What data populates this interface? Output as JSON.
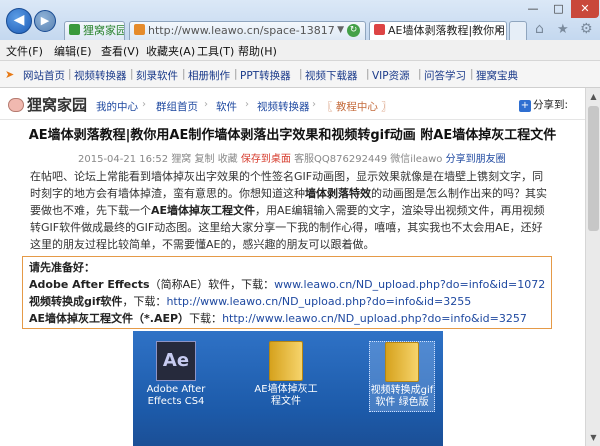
{
  "browser": {
    "window_controls": {
      "minimize": "—",
      "maximize": "□",
      "close": "✕"
    },
    "tabs": [
      {
        "label": "狸窝家园",
        "chip": "证"
      },
      {
        "label": "http://www.leawo.cn/space-13817"
      },
      {
        "label": "AE墙体剥落教程|教你用...",
        "close": "✕"
      }
    ],
    "menu": [
      "文件(F)",
      "编辑(E)",
      "查看(V)",
      "收藏夹(A)",
      "工具(T)",
      "帮助(H)"
    ],
    "favorites": [
      "网站首页",
      "视频转换器",
      "刻录软件",
      "相册制作",
      "PPT转换器",
      "视频下载器",
      "VIP资源",
      "问答学习",
      "狸窝宝典"
    ]
  },
  "page": {
    "logo": "狸窝家园",
    "breadcrumb": [
      "我的中心",
      "群组首页",
      "软件",
      "视频转换器",
      "〖 教程中心 〗"
    ],
    "share": "分享到:",
    "title": "AE墙体剥落教程|教你用AE制作墙体剥落出字效果和视频转gif动画 附AE墙体掉灰工程文件",
    "meta": {
      "date": "2015-04-21 16:52",
      "author": "狸窝",
      "copy": "复制",
      "collect": "收藏",
      "save": "保存到桌面",
      "contact": "客服QQ876292449 微信ileawo",
      "share_friends": "分享到朋友圈"
    },
    "paragraph": {
      "p1": "在帖吧、论坛上常能看到墙体掉灰出字效果的个性签名GIF动画图，显示效果就像是在墙壁上镌刻文字，同时刻字的地方会有墙体掉渣，蛮有意思的。你想知道这种",
      "b1": "墙体剥落特效",
      "p2": "的动画图是怎么制作出来的吗？其实要做也不难，先下载一个",
      "b2": "AE墙体掉灰工程文件",
      "p3": "，用AE编辑输入需要的文字，渲染导出视频文件，再用视频转GIF软件做成最终的GIF动态图。这里给大家分享一下我的制作心得，嘻嘻，其实我也不太会用AE，还好这里的朋友过程比较简单，不需要懂AE的，感兴趣的朋友可以跟着做。"
    },
    "prep": {
      "heading": "请先准备好：",
      "line1_bold": "Adobe After Effects",
      "line1_mid": "（简称AE）软件，下载：",
      "line1_link": "www.leawo.cn/ND_upload.php?do=info&id=1072",
      "line2_bold": "视频转换成gif软件",
      "line2_mid": "，下载：",
      "line2_link": "http://www.leawo.cn/ND_upload.php?do=info&id=3255",
      "line3_bold": "AE墙体掉灰工程文件（*.AEP）",
      "line3_mid": "下载：",
      "line3_link": "http://www.leawo.cn/ND_upload.php?do=info&id=3257"
    },
    "desktop_icons": [
      {
        "glyph": "Ae",
        "label": "Adobe After Effects CS4"
      },
      {
        "glyph": "",
        "label": "AE墙体掉灰工程文件"
      },
      {
        "glyph": "",
        "label": "视频转换成gif软件 绿色版"
      }
    ]
  }
}
